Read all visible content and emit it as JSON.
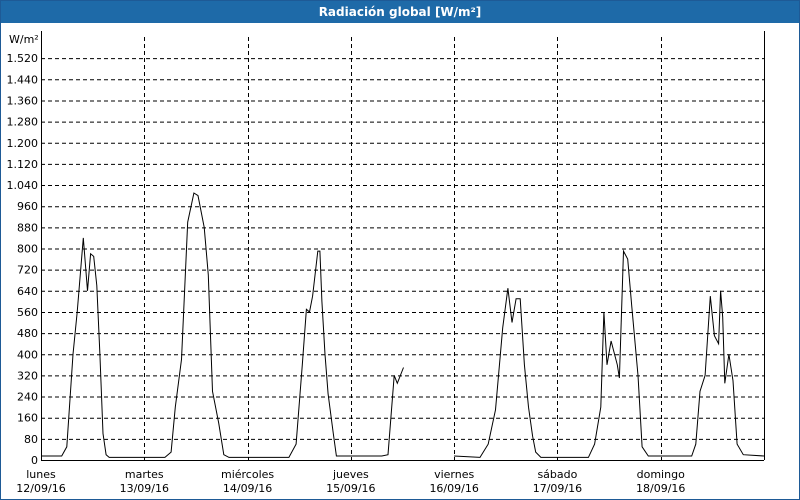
{
  "window": {
    "title": "Radiación global [W/m²]"
  },
  "chart_data": {
    "type": "line",
    "title": "Radiación global [W/m²]",
    "ylabel": "W/m²",
    "xlabel": "",
    "ylim": [
      0,
      1600
    ],
    "xlim": [
      0,
      7
    ],
    "grid": true,
    "yticks": [
      0,
      80,
      160,
      240,
      320,
      400,
      480,
      560,
      640,
      720,
      800,
      880,
      960,
      1040,
      1120,
      1200,
      1280,
      1360,
      1440,
      1520
    ],
    "ytick_labels": [
      "0",
      "80",
      "160",
      "240",
      "320",
      "400",
      "480",
      "560",
      "640",
      "720",
      "800",
      "880",
      "960",
      "1.040",
      "1.120",
      "1.200",
      "1.280",
      "1.360",
      "1.440",
      "1.520"
    ],
    "categories": [
      {
        "day": "lunes",
        "date": "12/09/16"
      },
      {
        "day": "martes",
        "date": "13/09/16"
      },
      {
        "day": "miércoles",
        "date": "14/09/16"
      },
      {
        "day": "jueves",
        "date": "15/09/16"
      },
      {
        "day": "viernes",
        "date": "16/09/16"
      },
      {
        "day": "sábado",
        "date": "17/09/16"
      },
      {
        "day": "domingo",
        "date": "18/09/16"
      }
    ],
    "series": [
      {
        "segments": [
          [
            [
              0,
              15
            ],
            [
              0.2,
              15
            ],
            [
              0.25,
              50
            ],
            [
              0.31,
              400
            ],
            [
              0.35,
              560
            ],
            [
              0.41,
              840
            ],
            [
              0.45,
              640
            ],
            [
              0.48,
              780
            ],
            [
              0.51,
              770
            ],
            [
              0.54,
              660
            ],
            [
              0.57,
              400
            ],
            [
              0.6,
              100
            ],
            [
              0.63,
              20
            ],
            [
              0.66,
              10
            ],
            [
              1.2,
              10
            ],
            [
              1.26,
              30
            ],
            [
              1.3,
              200
            ],
            [
              1.36,
              380
            ],
            [
              1.42,
              900
            ],
            [
              1.48,
              1010
            ],
            [
              1.52,
              1000
            ],
            [
              1.58,
              880
            ],
            [
              1.62,
              700
            ],
            [
              1.66,
              260
            ],
            [
              1.72,
              140
            ],
            [
              1.77,
              20
            ],
            [
              1.82,
              10
            ],
            [
              2.4,
              10
            ],
            [
              2.47,
              60
            ],
            [
              2.53,
              360
            ],
            [
              2.57,
              570
            ],
            [
              2.6,
              560
            ],
            [
              2.63,
              620
            ],
            [
              2.68,
              790
            ],
            [
              2.7,
              790
            ],
            [
              2.72,
              600
            ],
            [
              2.75,
              400
            ],
            [
              2.78,
              250
            ],
            [
              2.83,
              100
            ],
            [
              2.86,
              15
            ],
            [
              3.3,
              15
            ],
            [
              3.36,
              20
            ],
            [
              3.42,
              320
            ],
            [
              3.45,
              290
            ],
            [
              3.51,
              350
            ]
          ],
          [
            [
              4,
              15
            ],
            [
              4.25,
              10
            ],
            [
              4.33,
              60
            ],
            [
              4.4,
              190
            ],
            [
              4.47,
              500
            ],
            [
              4.52,
              650
            ],
            [
              4.56,
              520
            ],
            [
              4.6,
              610
            ],
            [
              4.64,
              610
            ],
            [
              4.68,
              360
            ],
            [
              4.72,
              200
            ],
            [
              4.76,
              90
            ],
            [
              4.79,
              30
            ],
            [
              4.84,
              10
            ],
            [
              5.3,
              10
            ],
            [
              5.36,
              60
            ],
            [
              5.42,
              200
            ],
            [
              5.45,
              560
            ],
            [
              5.48,
              360
            ],
            [
              5.52,
              450
            ],
            [
              5.58,
              360
            ],
            [
              5.6,
              310
            ],
            [
              5.64,
              790
            ],
            [
              5.68,
              760
            ],
            [
              5.72,
              580
            ],
            [
              5.78,
              320
            ],
            [
              5.82,
              50
            ],
            [
              5.88,
              15
            ],
            [
              6.3,
              15
            ],
            [
              6.34,
              60
            ],
            [
              6.38,
              260
            ],
            [
              6.43,
              320
            ],
            [
              6.48,
              620
            ],
            [
              6.52,
              470
            ],
            [
              6.56,
              440
            ],
            [
              6.58,
              640
            ],
            [
              6.6,
              540
            ],
            [
              6.62,
              290
            ],
            [
              6.66,
              400
            ],
            [
              6.7,
              300
            ],
            [
              6.74,
              60
            ],
            [
              6.8,
              20
            ],
            [
              7,
              15
            ]
          ]
        ]
      }
    ]
  }
}
